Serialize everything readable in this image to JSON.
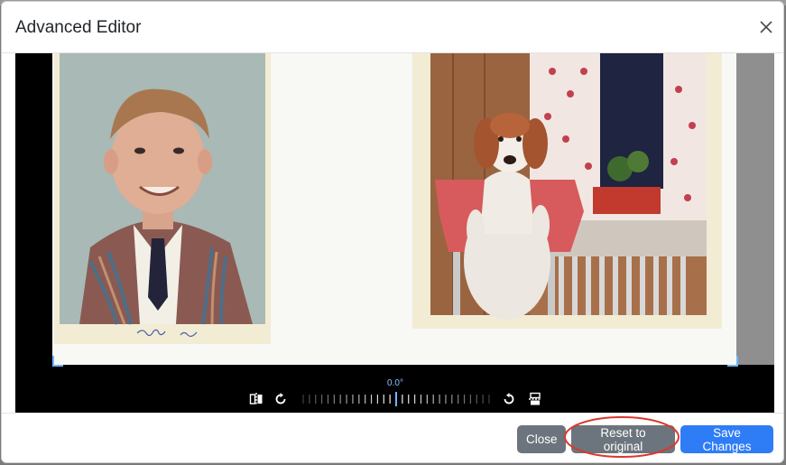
{
  "modal": {
    "title": "Advanced Editor"
  },
  "editor": {
    "rotation_label": "0.0°",
    "photos": [
      {
        "caption": "Shane 1962",
        "subject": "school portrait"
      },
      {
        "subject": "dog on chair"
      }
    ],
    "tools": [
      {
        "icon": "flip-horizontal-icon"
      },
      {
        "icon": "rotate-clockwise-icon"
      },
      {
        "icon": "rotate-counterclockwise-icon"
      },
      {
        "icon": "flip-vertical-icon"
      }
    ]
  },
  "footer": {
    "close_label": "Close",
    "reset_label": "Reset to original",
    "save_label": "Save Changes"
  },
  "colors": {
    "primary": "#2f7df6",
    "secondary": "#6c757d",
    "annotation": "#d9382c",
    "accent": "#6fb6ff"
  }
}
